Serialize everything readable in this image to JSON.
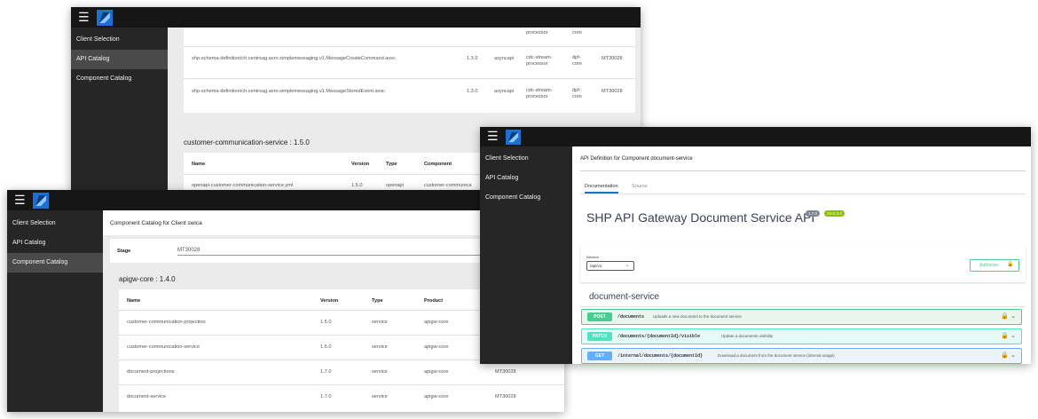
{
  "nav": {
    "client_selection": "Client Selection",
    "api_catalog": "API Catalog",
    "component_catalog": "Component Catalog"
  },
  "colors": {
    "post": "#49cc90",
    "patch": "#50e3c2",
    "get": "#61affe",
    "badge_version": "#89bf04"
  },
  "back": {
    "rows": [
      {
        "name": "shp-schema-definition/ch.centrsag.avro.simplemessaging.v1.MessageCreateCommand.avsc",
        "version": "1.3.0",
        "type": "asyncapi",
        "component": "cdc-stream-processor",
        "product": "dpf-core",
        "stage": "MT30028"
      },
      {
        "name": "shp-schema-definition/ch.centrsag.avro.simplemessaging.v1.MessageStoredEvent.avsc",
        "version": "1.3.0",
        "type": "asyncapi",
        "component": "cdc-stream-processor",
        "product": "dpf-core",
        "stage": "MT30028"
      }
    ],
    "partial_top": {
      "component": "processor",
      "product": "core"
    },
    "section_title": "customer-communication-service : 1.5.0",
    "headers": {
      "name": "Name",
      "version": "Version",
      "type": "Type",
      "component": "Component"
    },
    "row3": {
      "name": "openapi-customer-communication-service.yml",
      "version": "1.5.0",
      "type": "openapi",
      "component": "customer-communica"
    }
  },
  "catalog": {
    "title": "Component Catalog for Client swica",
    "stage_label": "Stage",
    "stage_value": "MT30028",
    "section": "apigw-core : 1.4.0",
    "headers": {
      "name": "Name",
      "version": "Version",
      "type": "Type",
      "product": "Product"
    },
    "rows": [
      {
        "name": "customer-communication-projection",
        "version": "1.5.0",
        "type": "service",
        "product": "apigw-core",
        "stage": ""
      },
      {
        "name": "customer-communication-service",
        "version": "1.5.0",
        "type": "service",
        "product": "apigw-core",
        "stage": ""
      },
      {
        "name": "document-projections",
        "version": "1.7.0",
        "type": "service",
        "product": "apigw-core",
        "stage": "MT30028"
      },
      {
        "name": "document-service",
        "version": "1.7.0",
        "type": "service",
        "product": "apigw-core",
        "stage": "MT30028"
      }
    ]
  },
  "apidef": {
    "title": "API Definition for Component document-service",
    "tab_documentation": "Documentation",
    "tab_source": "Source",
    "api_title": "SHP API Gateway Document Service API",
    "version_badge": "1.7.0",
    "oas_badge": "OAS 3.0",
    "servers_label": "Servers",
    "server_value": "/api/v1",
    "authorize_label": "Authorize",
    "group_name": "document-service",
    "operations": [
      {
        "method": "POST",
        "path": "/documents",
        "desc": "Uploads a new document to the document service"
      },
      {
        "method": "PATCH",
        "path": "/documents/{documentId}/visible",
        "desc": "Update a documents visibility"
      },
      {
        "method": "GET",
        "path": "/internal/documents/{documentId}",
        "desc": "Download a document from the document service (internal usage)"
      }
    ]
  }
}
